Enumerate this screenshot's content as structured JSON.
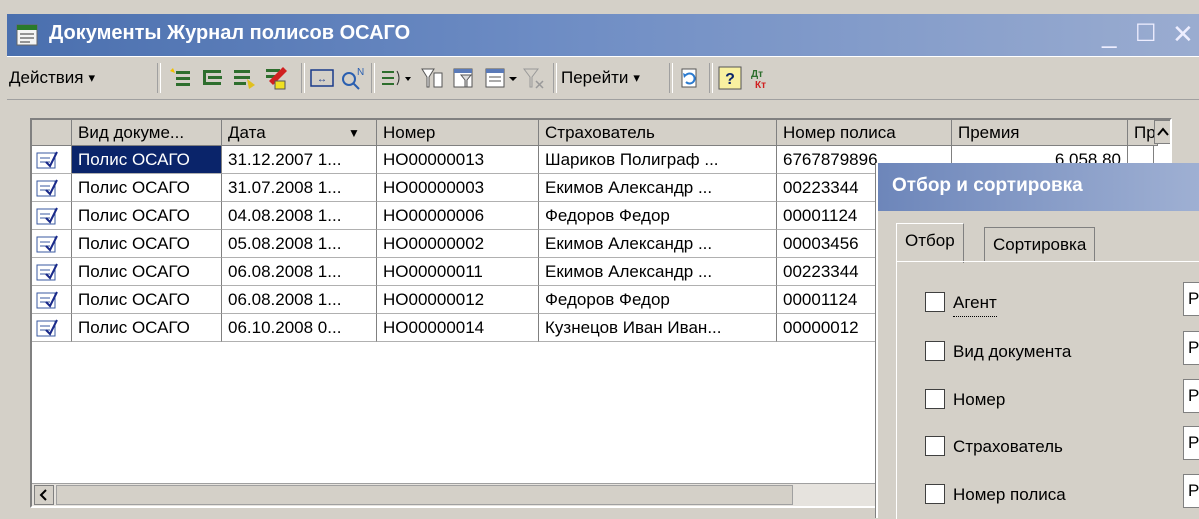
{
  "window": {
    "title": "Документы Журнал полисов ОСАГО",
    "min_glyph": "_",
    "max_glyph": "☐",
    "close_glyph": "✕"
  },
  "toolbar": {
    "actions_label": "Действия",
    "goto_label": "Перейти",
    "dropdown_glyph": "▾",
    "icons": [
      "add-document-icon",
      "copy-document-icon",
      "add-group-icon",
      "edit-icon",
      "delete-icon",
      "period-icon",
      "find-icon",
      "list-menu-icon",
      "filter-icon",
      "filter-by-value-icon",
      "sort-icon",
      "clear-filter-icon",
      "refresh-icon",
      "help-icon",
      "debit-credit-icon"
    ]
  },
  "grid": {
    "columns": [
      "Вид докуме...",
      "Дата",
      "Номер",
      "Страхователь",
      "Номер полиса",
      "Премия",
      "Пре"
    ],
    "sort_glyph": "▼",
    "rows": [
      [
        "Полис ОСАГО",
        "31.12.2007 1...",
        "НО00000013",
        "Шариков Полиграф ...",
        "6767879896",
        "6 058,80",
        ""
      ],
      [
        "Полис ОСАГО",
        "31.07.2008 1...",
        "НО00000003",
        "Екимов Александр ...",
        "00223344",
        "",
        ""
      ],
      [
        "Полис ОСАГО",
        "04.08.2008 1...",
        "НО00000006",
        "Федоров Федор",
        "00001124",
        "",
        ""
      ],
      [
        "Полис ОСАГО",
        "05.08.2008 1...",
        "НО00000002",
        "Екимов Александр ...",
        "00003456",
        "",
        ""
      ],
      [
        "Полис ОСАГО",
        "06.08.2008 1...",
        "НО00000011",
        "Екимов Александр ...",
        "00223344",
        "",
        ""
      ],
      [
        "Полис ОСАГО",
        "06.08.2008 1...",
        "НО00000012",
        "Федоров Федор",
        "00001124",
        "",
        ""
      ],
      [
        "Полис ОСАГО",
        "06.10.2008 0...",
        "НО00000014",
        "Кузнецов Иван Иван...",
        "00000012",
        "",
        ""
      ]
    ]
  },
  "dialog": {
    "title": "Отбор и сортировка",
    "tabs": [
      "Отбор",
      "Сортировка"
    ],
    "filters": [
      {
        "label": "Агент",
        "condition": "Равно"
      },
      {
        "label": "Вид документа",
        "condition": "Равно"
      },
      {
        "label": "Номер",
        "condition": "Равно"
      },
      {
        "label": "Страхователь",
        "condition": "Равно"
      },
      {
        "label": "Номер полиса",
        "condition": "Равно"
      }
    ]
  },
  "colors": {
    "title_bar": "#4a6fae",
    "selection": "#0a246a",
    "face": "#d4d0c8"
  }
}
